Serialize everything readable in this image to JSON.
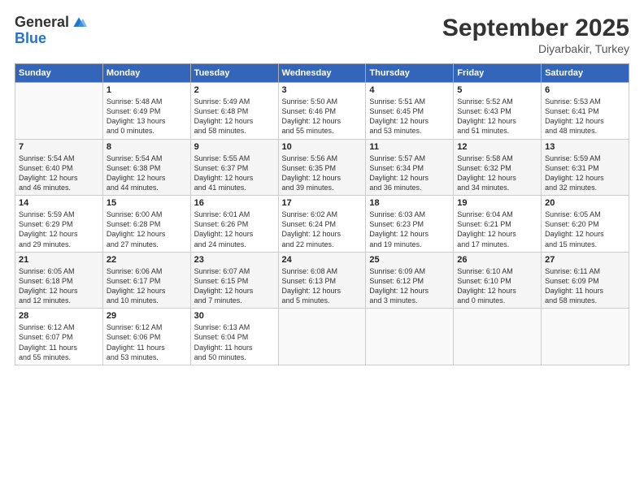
{
  "logo": {
    "general": "General",
    "blue": "Blue"
  },
  "title": "September 2025",
  "subtitle": "Diyarbakir, Turkey",
  "days_header": [
    "Sunday",
    "Monday",
    "Tuesday",
    "Wednesday",
    "Thursday",
    "Friday",
    "Saturday"
  ],
  "weeks": [
    [
      {
        "num": "",
        "info": ""
      },
      {
        "num": "1",
        "info": "Sunrise: 5:48 AM\nSunset: 6:49 PM\nDaylight: 13 hours\nand 0 minutes."
      },
      {
        "num": "2",
        "info": "Sunrise: 5:49 AM\nSunset: 6:48 PM\nDaylight: 12 hours\nand 58 minutes."
      },
      {
        "num": "3",
        "info": "Sunrise: 5:50 AM\nSunset: 6:46 PM\nDaylight: 12 hours\nand 55 minutes."
      },
      {
        "num": "4",
        "info": "Sunrise: 5:51 AM\nSunset: 6:45 PM\nDaylight: 12 hours\nand 53 minutes."
      },
      {
        "num": "5",
        "info": "Sunrise: 5:52 AM\nSunset: 6:43 PM\nDaylight: 12 hours\nand 51 minutes."
      },
      {
        "num": "6",
        "info": "Sunrise: 5:53 AM\nSunset: 6:41 PM\nDaylight: 12 hours\nand 48 minutes."
      }
    ],
    [
      {
        "num": "7",
        "info": "Sunrise: 5:54 AM\nSunset: 6:40 PM\nDaylight: 12 hours\nand 46 minutes."
      },
      {
        "num": "8",
        "info": "Sunrise: 5:54 AM\nSunset: 6:38 PM\nDaylight: 12 hours\nand 44 minutes."
      },
      {
        "num": "9",
        "info": "Sunrise: 5:55 AM\nSunset: 6:37 PM\nDaylight: 12 hours\nand 41 minutes."
      },
      {
        "num": "10",
        "info": "Sunrise: 5:56 AM\nSunset: 6:35 PM\nDaylight: 12 hours\nand 39 minutes."
      },
      {
        "num": "11",
        "info": "Sunrise: 5:57 AM\nSunset: 6:34 PM\nDaylight: 12 hours\nand 36 minutes."
      },
      {
        "num": "12",
        "info": "Sunrise: 5:58 AM\nSunset: 6:32 PM\nDaylight: 12 hours\nand 34 minutes."
      },
      {
        "num": "13",
        "info": "Sunrise: 5:59 AM\nSunset: 6:31 PM\nDaylight: 12 hours\nand 32 minutes."
      }
    ],
    [
      {
        "num": "14",
        "info": "Sunrise: 5:59 AM\nSunset: 6:29 PM\nDaylight: 12 hours\nand 29 minutes."
      },
      {
        "num": "15",
        "info": "Sunrise: 6:00 AM\nSunset: 6:28 PM\nDaylight: 12 hours\nand 27 minutes."
      },
      {
        "num": "16",
        "info": "Sunrise: 6:01 AM\nSunset: 6:26 PM\nDaylight: 12 hours\nand 24 minutes."
      },
      {
        "num": "17",
        "info": "Sunrise: 6:02 AM\nSunset: 6:24 PM\nDaylight: 12 hours\nand 22 minutes."
      },
      {
        "num": "18",
        "info": "Sunrise: 6:03 AM\nSunset: 6:23 PM\nDaylight: 12 hours\nand 19 minutes."
      },
      {
        "num": "19",
        "info": "Sunrise: 6:04 AM\nSunset: 6:21 PM\nDaylight: 12 hours\nand 17 minutes."
      },
      {
        "num": "20",
        "info": "Sunrise: 6:05 AM\nSunset: 6:20 PM\nDaylight: 12 hours\nand 15 minutes."
      }
    ],
    [
      {
        "num": "21",
        "info": "Sunrise: 6:05 AM\nSunset: 6:18 PM\nDaylight: 12 hours\nand 12 minutes."
      },
      {
        "num": "22",
        "info": "Sunrise: 6:06 AM\nSunset: 6:17 PM\nDaylight: 12 hours\nand 10 minutes."
      },
      {
        "num": "23",
        "info": "Sunrise: 6:07 AM\nSunset: 6:15 PM\nDaylight: 12 hours\nand 7 minutes."
      },
      {
        "num": "24",
        "info": "Sunrise: 6:08 AM\nSunset: 6:13 PM\nDaylight: 12 hours\nand 5 minutes."
      },
      {
        "num": "25",
        "info": "Sunrise: 6:09 AM\nSunset: 6:12 PM\nDaylight: 12 hours\nand 3 minutes."
      },
      {
        "num": "26",
        "info": "Sunrise: 6:10 AM\nSunset: 6:10 PM\nDaylight: 12 hours\nand 0 minutes."
      },
      {
        "num": "27",
        "info": "Sunrise: 6:11 AM\nSunset: 6:09 PM\nDaylight: 11 hours\nand 58 minutes."
      }
    ],
    [
      {
        "num": "28",
        "info": "Sunrise: 6:12 AM\nSunset: 6:07 PM\nDaylight: 11 hours\nand 55 minutes."
      },
      {
        "num": "29",
        "info": "Sunrise: 6:12 AM\nSunset: 6:06 PM\nDaylight: 11 hours\nand 53 minutes."
      },
      {
        "num": "30",
        "info": "Sunrise: 6:13 AM\nSunset: 6:04 PM\nDaylight: 11 hours\nand 50 minutes."
      },
      {
        "num": "",
        "info": ""
      },
      {
        "num": "",
        "info": ""
      },
      {
        "num": "",
        "info": ""
      },
      {
        "num": "",
        "info": ""
      }
    ]
  ]
}
